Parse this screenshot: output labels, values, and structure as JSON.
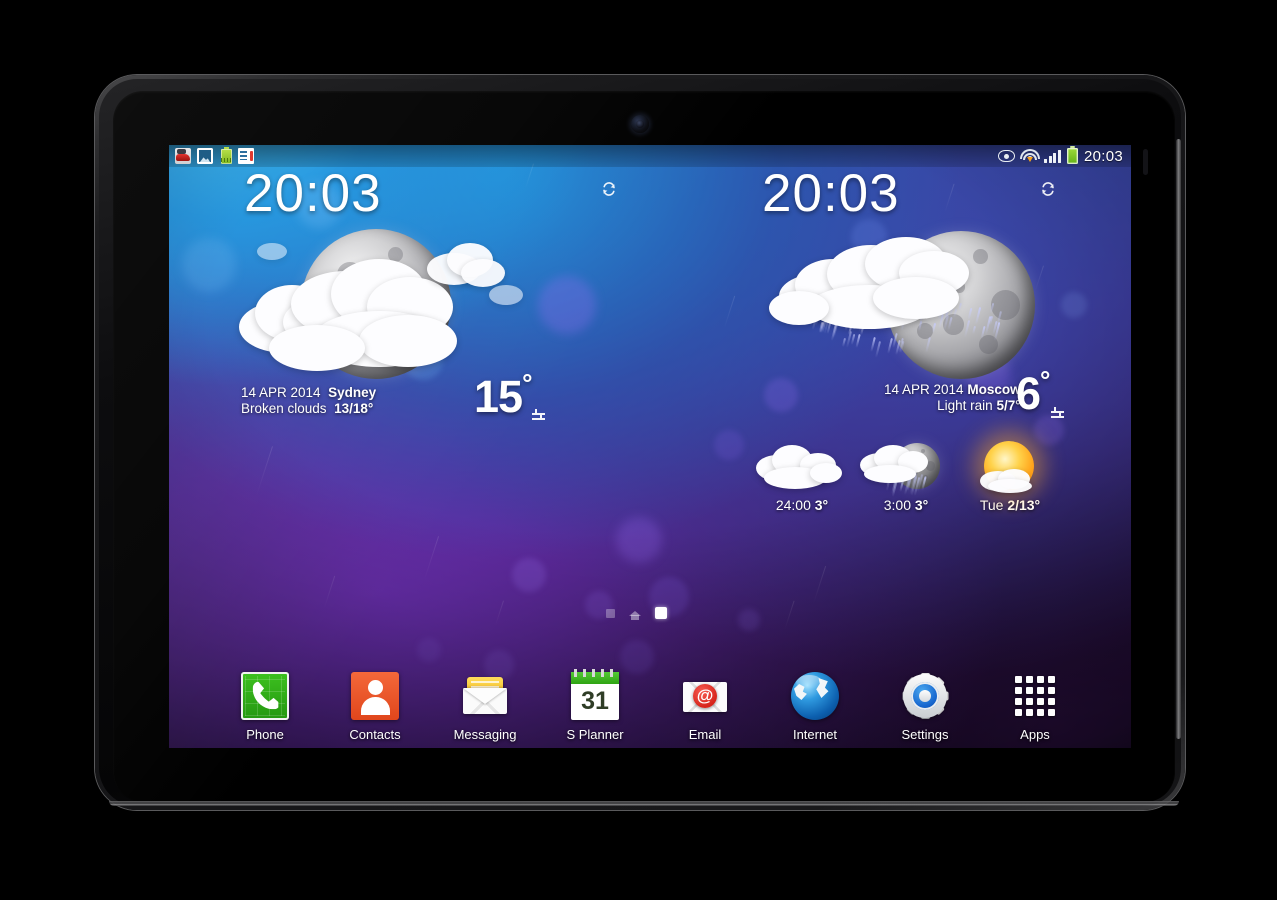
{
  "status_bar": {
    "notification_icons": [
      "racing-game-icon",
      "gallery-icon",
      "battery-notification-icon",
      "report-document-icon"
    ],
    "right_icons": [
      "smart-stay-eye-icon",
      "wifi-icon",
      "signal-bars-icon",
      "battery-icon"
    ],
    "time": "20:03"
  },
  "widgets": {
    "left": {
      "clock": "20:03",
      "refresh_icon": "refresh-icon",
      "weather_icon": "moon-behind-clouds-icon",
      "date": "14 APR 2014",
      "city": "Sydney",
      "condition": "Broken clouds",
      "range": "13/18°",
      "temperature": "15",
      "degree": "°",
      "unit_toggle_icon": "celsius-fahrenheit-toggle-icon"
    },
    "right": {
      "clock": "20:03",
      "refresh_icon": "refresh-icon",
      "weather_icon": "rain-moon-icon",
      "date": "14 APR 2014",
      "city": "Moscow",
      "condition": "Light rain",
      "range": "5/7°",
      "temperature": "6",
      "degree": "°",
      "unit_toggle_icon": "celsius-fahrenheit-toggle-icon",
      "forecast": [
        {
          "icon": "cloudy-icon",
          "time": "24:00",
          "temp": "3°"
        },
        {
          "icon": "rain-moon-icon",
          "time": "3:00",
          "temp": "3°"
        },
        {
          "icon": "sun-cloud-icon",
          "time": "Tue",
          "temp": "2/13°"
        }
      ]
    }
  },
  "page_indicator": {
    "pages": 3,
    "active_index": 2,
    "home_index": 1
  },
  "dock": {
    "items": [
      {
        "label": "Phone",
        "icon": "phone-icon"
      },
      {
        "label": "Contacts",
        "icon": "contacts-icon"
      },
      {
        "label": "Messaging",
        "icon": "messaging-icon"
      },
      {
        "label": "S Planner",
        "icon": "calendar-icon",
        "day": "31"
      },
      {
        "label": "Email",
        "icon": "email-icon",
        "glyph": "@"
      },
      {
        "label": "Internet",
        "icon": "globe-icon"
      },
      {
        "label": "Settings",
        "icon": "gear-icon"
      },
      {
        "label": "Apps",
        "icon": "apps-grid-icon"
      }
    ]
  },
  "colors": {
    "sky_blue": "#2b9de0",
    "purple": "#5a2f9e",
    "battery_green": "#8fd12e",
    "phone_green": "#2ea712",
    "contacts_orange": "#e8562b",
    "messaging_yellow": "#f5c22b",
    "calendar_green": "#3fb81c",
    "email_red": "#d9271d",
    "internet_blue": "#1b79c8",
    "settings_blue": "#1565cf"
  }
}
